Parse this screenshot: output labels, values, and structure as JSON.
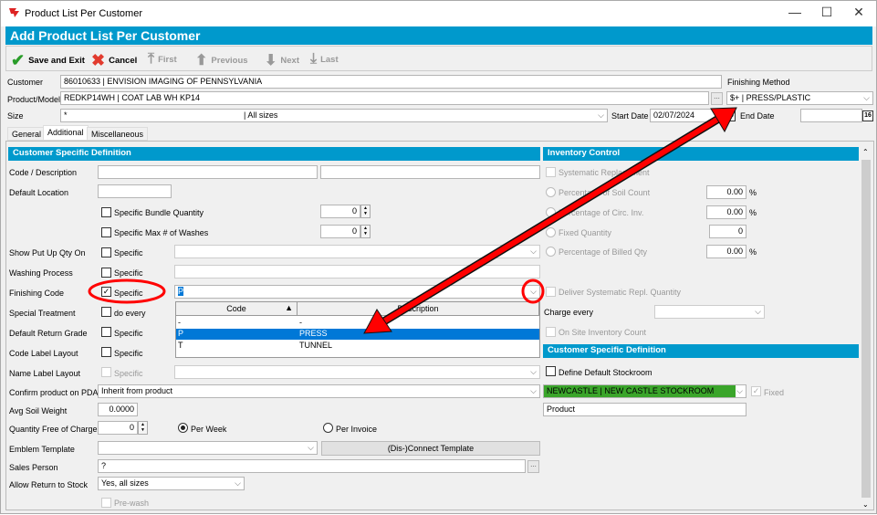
{
  "window": {
    "title": "Product List Per Customer",
    "minimize": "—",
    "maximize": "☐",
    "close": "✕"
  },
  "header": {
    "title": "Add Product List Per Customer"
  },
  "toolbar": {
    "save": "Save and Exit",
    "cancel": "Cancel",
    "first": "First",
    "previous": "Previous",
    "next": "Next",
    "last": "Last"
  },
  "top": {
    "customer_label": "Customer",
    "customer_value": "86010633      | ENVISION IMAGING OF PENNSYLVANIA",
    "product_label": "Product/Model",
    "product_value": "REDKP14WH     | COAT LAB WH KP14",
    "size_label": "Size",
    "size_value": "*",
    "size_desc": "| All sizes",
    "finishing_method_label": "Finishing Method",
    "finishing_method_value": "$+                  | PRESS/PLASTIC",
    "start_date_label": "Start Date",
    "start_date_value": "02/07/2024",
    "end_date_label": "End Date",
    "end_date_value": "",
    "calendar": "16",
    "ellipsis": "..."
  },
  "tabs": [
    "General",
    "Additional",
    "Miscellaneous"
  ],
  "left": {
    "section_title": "Customer Specific Definition",
    "code_description": "Code / Description",
    "default_location": "Default Location",
    "specific_bundle_quantity": "Specific Bundle Quantity",
    "bundle_value": "0",
    "specific_max_washes": "Specific Max # of Washes",
    "washes_value": "0",
    "show_put_up": "Show Put Up Qty On",
    "washing_process": "Washing Process",
    "finishing_code": "Finishing Code",
    "finishing_code_value": "P",
    "special_treatment": "Special Treatment",
    "do_every": "do every",
    "default_return_grade": "Default Return Grade",
    "code_label_layout": "Code Label Layout",
    "name_label_layout": "Name Label Layout",
    "specific": "Specific",
    "confirm_pda": "Confirm product on PDA",
    "confirm_pda_value": "Inherit from product",
    "avg_soil_weight": "Avg Soil Weight",
    "avg_soil_value": "0.0000",
    "qty_free": "Quantity Free of Charge",
    "qty_free_value": "0",
    "per_week": "Per Week",
    "per_invoice": "Per Invoice",
    "emblem_template": "Emblem Template",
    "connect_template": "(Dis-)Connect Template",
    "sales_person": "Sales Person",
    "sales_person_value": "?",
    "allow_return": "Allow Return to Stock",
    "allow_return_value": "Yes, all sizes",
    "pre_wash": "Pre-wash"
  },
  "dropdown": {
    "columns": [
      "Code",
      "Description"
    ],
    "rows": [
      {
        "code": "-",
        "desc": "-"
      },
      {
        "code": "P",
        "desc": "PRESS",
        "selected": true
      },
      {
        "code": "T",
        "desc": "TUNNEL"
      }
    ]
  },
  "right": {
    "inventory_title": "Inventory Control",
    "systematic_replacement": "Systematic Replacement",
    "pct_soil": "Percentage of Soil Count",
    "pct_soil_value": "0.00",
    "pct_circ": "Percentage of Circ. Inv.",
    "pct_circ_value": "0.00",
    "fixed_qty": "Fixed Quantity",
    "fixed_qty_value": "0",
    "pct_billed": "Percentage of Billed Qty",
    "pct_billed_value": "0.00",
    "pct": "%",
    "deliver_repl": "Deliver Systematic Repl. Quantity",
    "charge_every": "Charge every",
    "on_site": "On Site Inventory Count",
    "csd_title": "Customer Specific Definition",
    "define_stockroom": "Define Default Stockroom",
    "stockroom_value": "NEWCASTLE        | NEW CASTLE STOCKROOM",
    "fixed": "Fixed",
    "product_value": "Product"
  },
  "colors": {
    "header": "#0099cc",
    "selection": "#0078d7",
    "stockroom": "#3aa52a",
    "annotation": "#ff0000"
  }
}
